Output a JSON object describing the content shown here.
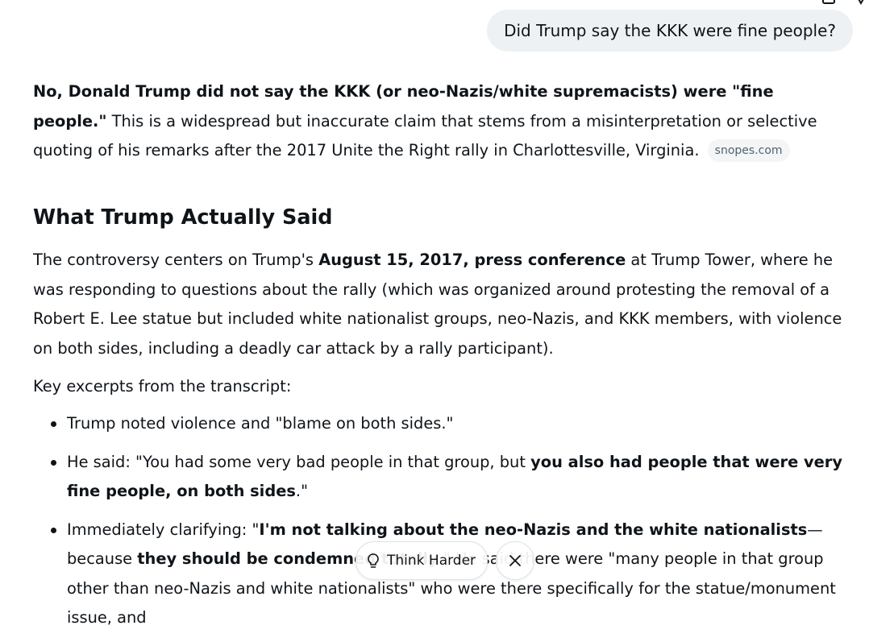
{
  "user_message": "Did Trump say the KKK were fine people?",
  "response": {
    "intro": {
      "bold": "No, Donald Trump did not say the KKK (or neo-Nazis/white supremacists) were \"fine people.\"",
      "text": " This is a widespread but inaccurate claim that stems from a misinterpretation or selective quoting of his remarks after the 2017 Unite the Right rally in Charlottesville, Virginia.",
      "citation": "snopes.com"
    },
    "heading": "What Trump Actually Said",
    "para2": {
      "pre": "The controversy centers on Trump's ",
      "bold": "August 15, 2017, press conference",
      "post": " at Trump Tower, where he was responding to questions about the rally (which was organized around protesting the removal of a Robert E. Lee statue but included white nationalist groups, neo-Nazis, and KKK members, with violence on both sides, including a deadly car attack by a rally participant)."
    },
    "para3": "Key excerpts from the transcript:",
    "bullets": {
      "b1": "Trump noted violence and \"blame on both sides.\"",
      "b2_pre": "He said: \"You had some very bad people in that group, but ",
      "b2_bold": "you also had people that were very fine people, on both sides",
      "b2_post": ".\"",
      "b3_pre": "Immediately clarifying: \"",
      "b3_bold1": "I'm not talking about the neo-Nazis and the white nationalists",
      "b3_mid": "—because ",
      "b3_bold2": "they should be condemned totally",
      "b3_post": ".\" He said there were \"many people in that group other than neo-Nazis and white nationalists\" who were there specifically for the statue/monument issue, and"
    }
  },
  "actions": {
    "think_harder": "Think Harder"
  },
  "icons": {
    "think": "lightbulb-icon",
    "close": "close-icon"
  }
}
